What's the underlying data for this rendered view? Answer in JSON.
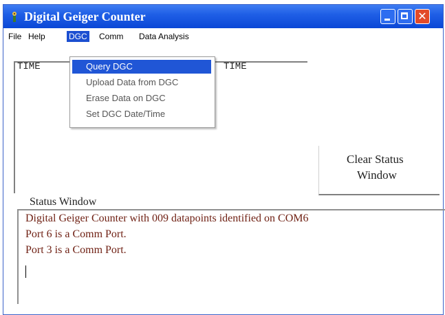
{
  "window": {
    "title": "Digital Geiger Counter",
    "icons": {
      "app": "radiation-app-icon",
      "minimize": "minimize-icon",
      "maximize": "maximize-icon",
      "close": "close-icon"
    },
    "close_glyph": "✕"
  },
  "menubar": {
    "file": "File",
    "help": "Help",
    "dgc": "DGC",
    "comm": "Comm",
    "data_analysis": "Data Analysis"
  },
  "dgc_menu": {
    "items": [
      "Query DGC",
      "Upload Data from DGC",
      "Erase Data on DGC",
      "Set DGC Date/Time"
    ],
    "highlighted": "Query DGC"
  },
  "list": {
    "columns": [
      "TIME",
      "TIME"
    ]
  },
  "clear_button": {
    "line1": "Clear Status",
    "line2": "Window"
  },
  "status": {
    "label": "Status Window",
    "lines": [
      "Digital Geiger Counter with 009 datapoints identified on COM6",
      "Port 6 is a Comm Port.",
      "Port 3 is a Comm Port."
    ]
  },
  "colors": {
    "titlebar": "#1f5fe6",
    "menu_highlight": "#2056d6",
    "status_text": "#6e1f12"
  }
}
